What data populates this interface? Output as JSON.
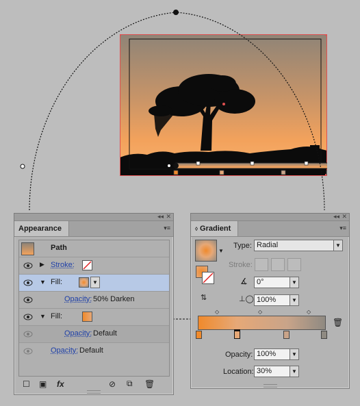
{
  "colors": {
    "gradient_start": "#f08a2c",
    "gradient_mid": "#e6a877",
    "gradient_end": "#8f8a82",
    "selection": "#e05050",
    "selected_row": "#b7c9e6"
  },
  "appearance": {
    "tab_label": "Appearance",
    "header": "Path",
    "rows": [
      {
        "label": "Stroke:",
        "is_link": true
      },
      {
        "label": "Fill:",
        "is_link": false
      },
      {
        "label": "Opacity:",
        "value": "50% Darken"
      },
      {
        "label": "Fill:",
        "is_link": false
      },
      {
        "label": "Opacity:",
        "value": "Default"
      },
      {
        "label": "Opacity:",
        "value": "Default"
      }
    ],
    "footer_fx": "fx"
  },
  "gradient": {
    "tab_label": "Gradient",
    "type_label": "Type:",
    "type_value": "Radial",
    "stroke_label": "Stroke:",
    "angle_value": "0°",
    "aspect_value": "100%",
    "opacity_label": "Opacity:",
    "opacity_value": "100%",
    "location_label": "Location:",
    "location_value": "30%",
    "stop_locations": [
      0,
      30,
      70,
      100
    ]
  }
}
